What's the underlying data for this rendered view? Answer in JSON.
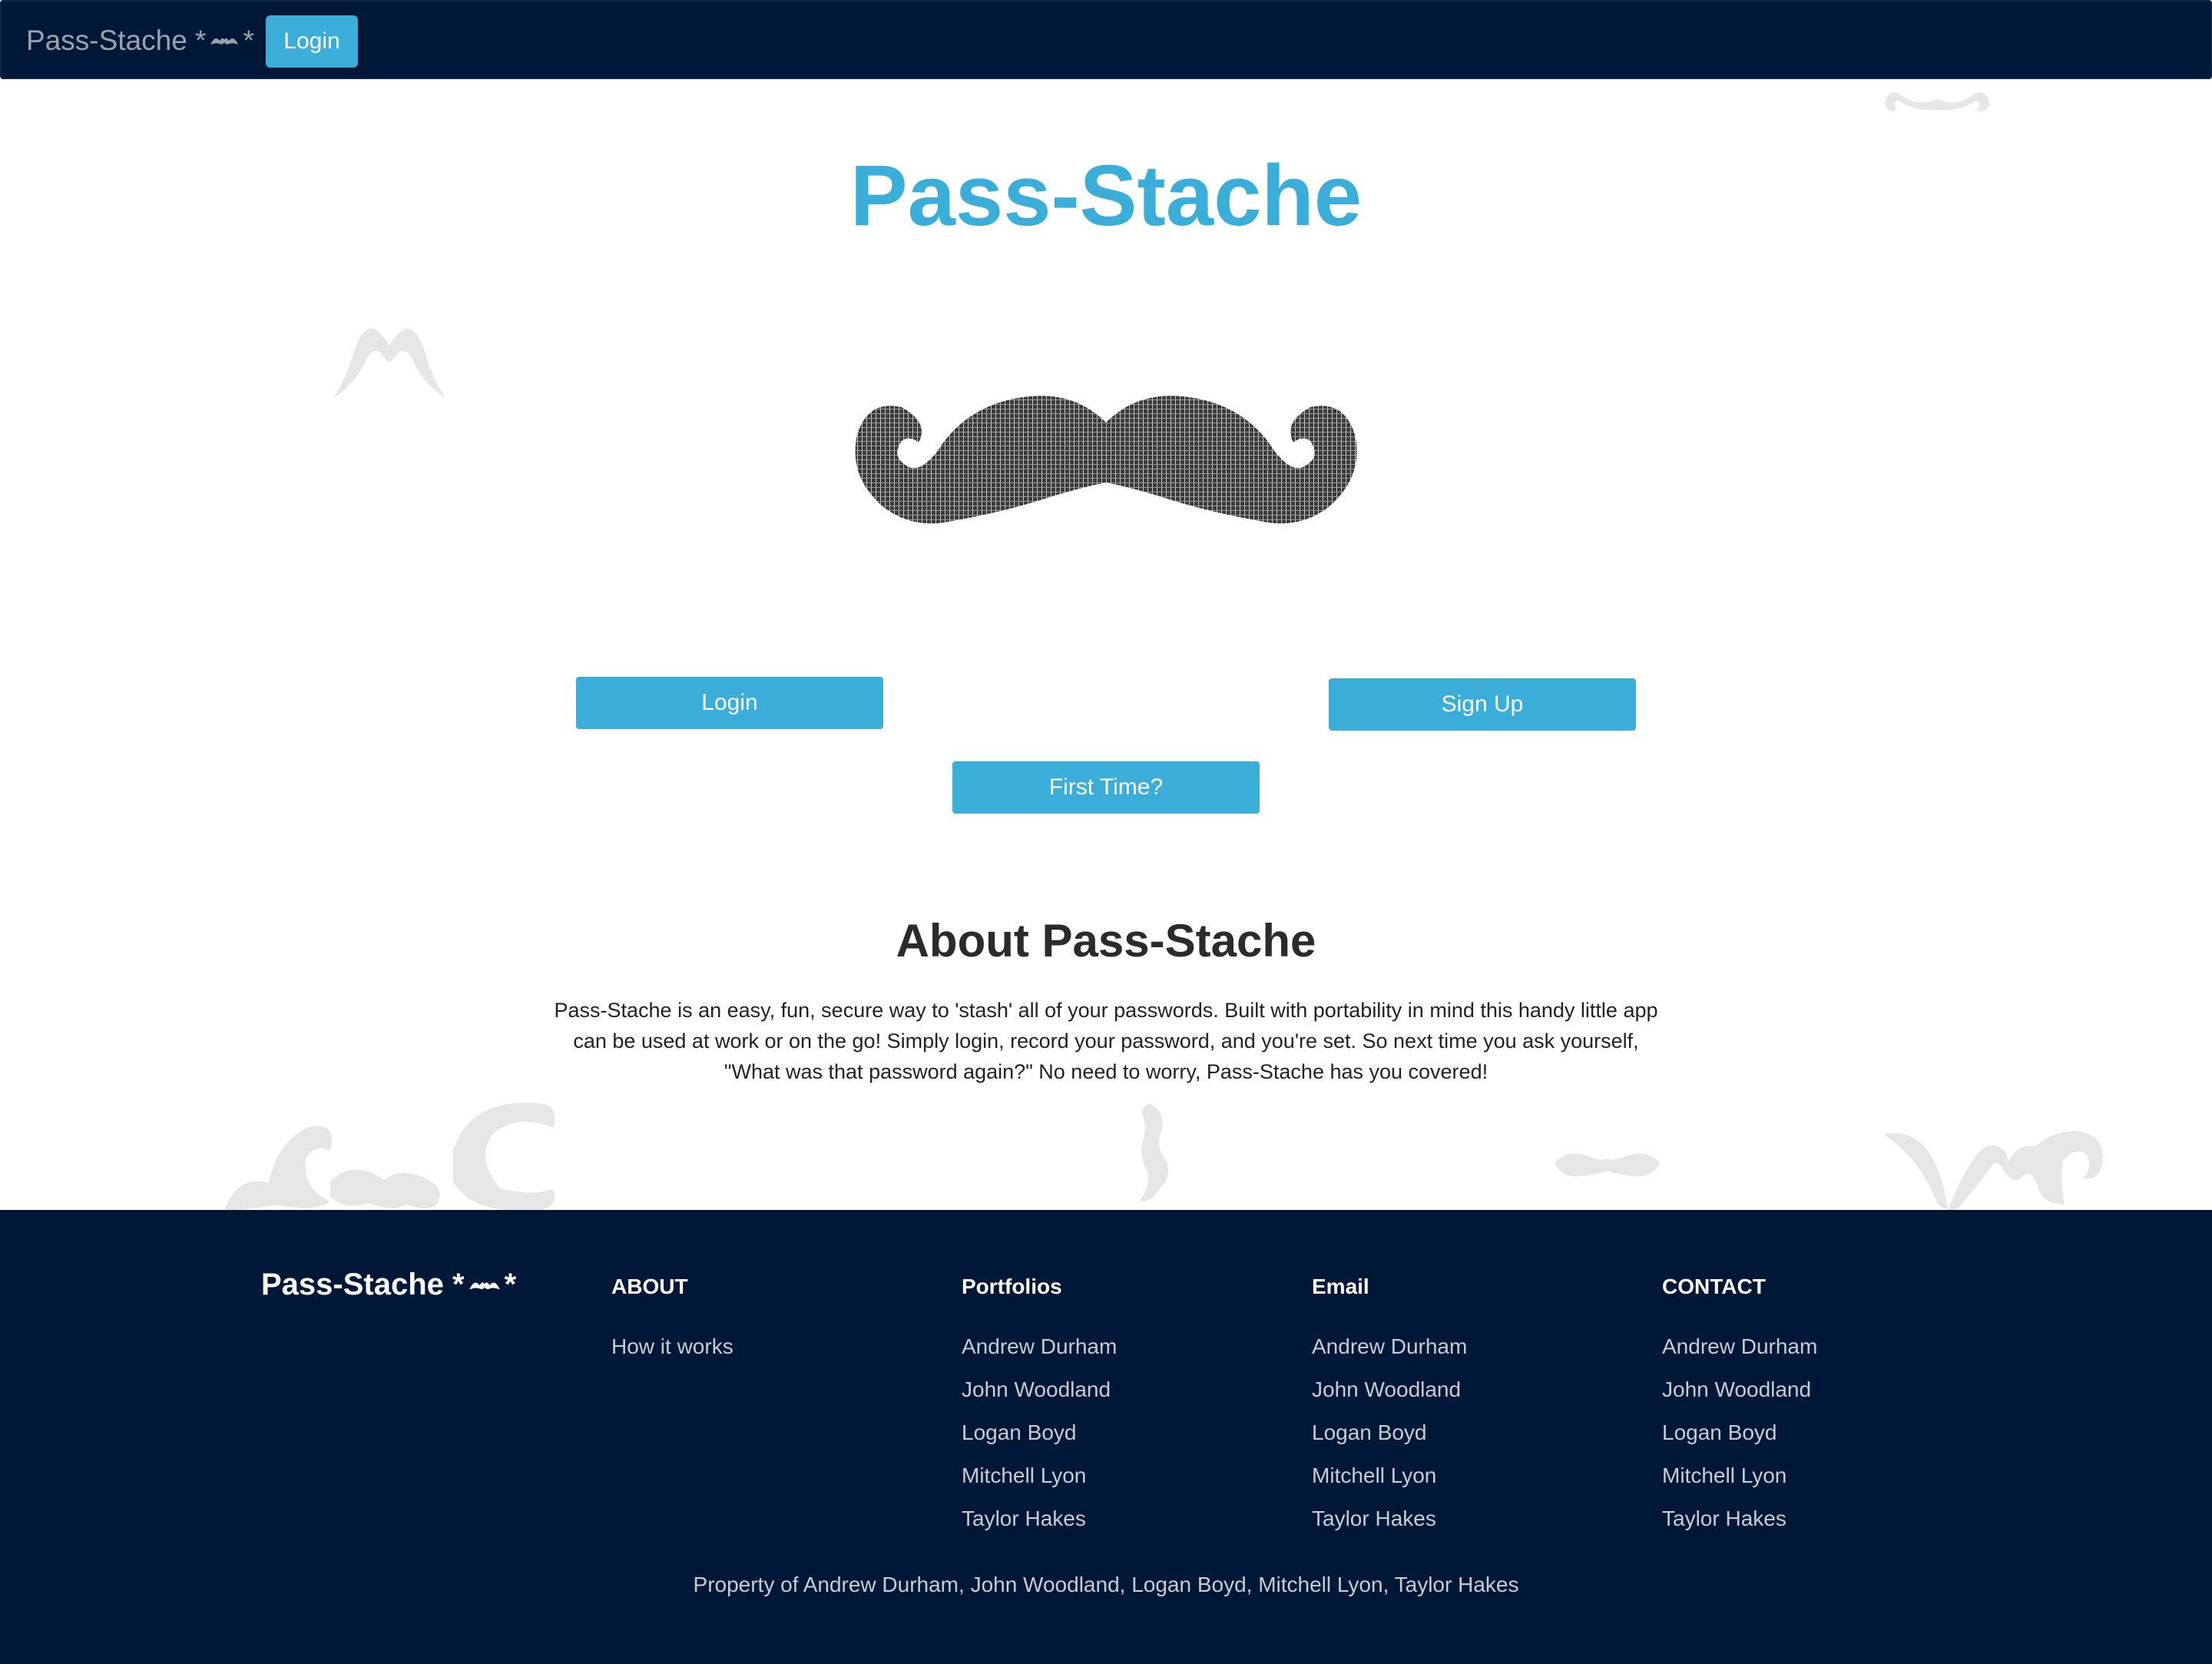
{
  "colors": {
    "navbar_bg": "#001838",
    "accent": "#3aaed8",
    "footer_bg": "#001838",
    "deco_gray": "#e6e6e6",
    "stache_dark": "#4a4a4a"
  },
  "navbar": {
    "brand_text": "Pass-Stache *",
    "brand_suffix": "*",
    "brand_icon": "mustache-icon",
    "login_label": "Login"
  },
  "hero": {
    "title": "Pass-Stache",
    "image_icon": "mustache-icon"
  },
  "actions": {
    "login_label": "Login",
    "signup_label": "Sign Up",
    "first_time_label": "First Time?"
  },
  "about": {
    "title": "About Pass-Stache",
    "text": "Pass-Stache is an easy, fun, secure way to 'stash' all of your passwords. Built with portability in mind this handy little app can be used at work or on the go! Simply login, record your password, and you're set. So next time you ask yourself, \"What was that password again?\" No need to worry, Pass-Stache has you covered!"
  },
  "footer": {
    "brand_text": "Pass-Stache *",
    "brand_suffix": "*",
    "columns": [
      {
        "heading": "ABOUT",
        "items": [
          "How it works"
        ]
      },
      {
        "heading": "Portfolios",
        "items": [
          "Andrew Durham",
          "John Woodland",
          "Logan Boyd",
          "Mitchell Lyon",
          "Taylor Hakes"
        ]
      },
      {
        "heading": "Email",
        "items": [
          "Andrew Durham",
          "John Woodland",
          "Logan Boyd",
          "Mitchell Lyon",
          "Taylor Hakes"
        ]
      },
      {
        "heading": "CONTACT",
        "items": [
          "Andrew Durham",
          "John Woodland",
          "Logan Boyd",
          "Mitchell Lyon",
          "Taylor Hakes"
        ]
      }
    ],
    "copyright": "Property of Andrew Durham, John Woodland, Logan Boyd, Mitchell Lyon, Taylor Hakes"
  }
}
